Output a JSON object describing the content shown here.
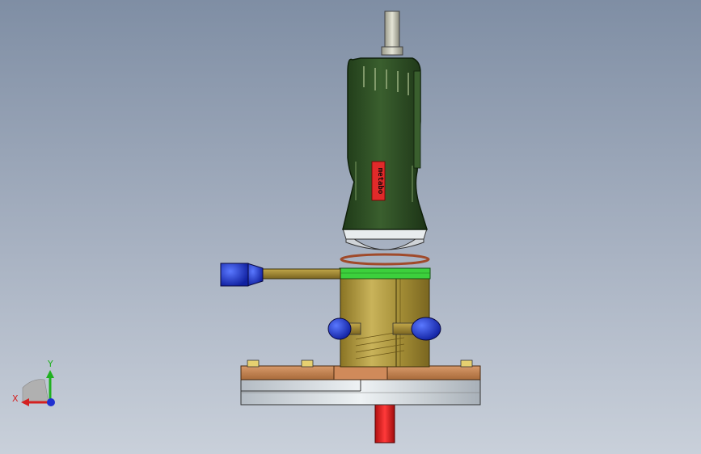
{
  "viewport": {
    "background_top": "#7f8ea4",
    "background_bottom": "#c9d0da"
  },
  "tool": {
    "brand_text": "metabo",
    "housing_color": "#2d4d25",
    "label_color": "#e02a2a"
  },
  "fixture": {
    "top_ring_color": "#3cd03c",
    "body_color": "#a8923a",
    "handle_color": "#1f3fcc",
    "base_color": "#c88a5a",
    "plate_color": "#c8ced4",
    "post_color": "#e01e1e"
  },
  "triad": {
    "x_label": "X",
    "y_label": "Y",
    "x_color": "#d42020",
    "y_color": "#20b020",
    "z_color": "#2030d0"
  }
}
